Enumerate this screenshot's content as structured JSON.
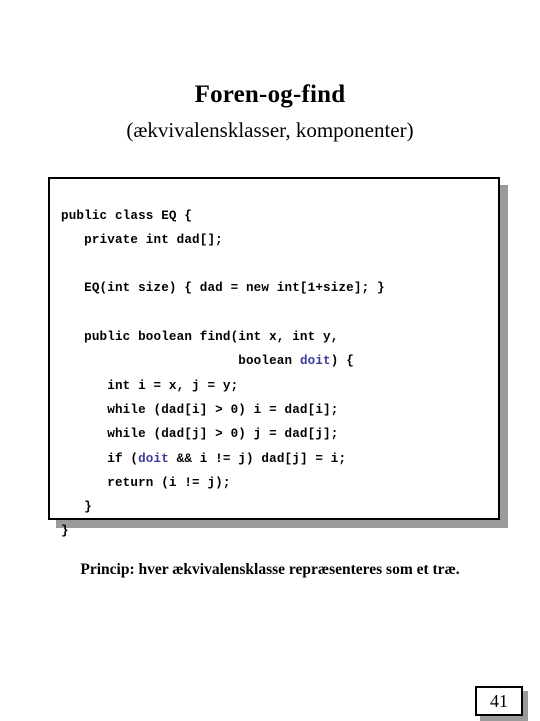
{
  "slide": {
    "title": "Foren-og-find",
    "subtitle": "(ækvivalensklasser, komponenter)",
    "caption": "Princip: hver ækvivalensklasse repræsenteres som et træ.",
    "page_number": "41"
  },
  "code": {
    "language": "java",
    "highlight_color": "#3a3a9c",
    "lines": [
      {
        "id": "l1",
        "text": "public class EQ {"
      },
      {
        "id": "l2",
        "text": "   private int dad[];"
      },
      {
        "id": "l3",
        "text": ""
      },
      {
        "id": "l4",
        "text": "   EQ(int size) { dad = new int[1+size]; }"
      },
      {
        "id": "l5",
        "text": ""
      },
      {
        "id": "l6",
        "pre": "   public boolean find(int x, int y,"
      },
      {
        "id": "l7",
        "pre": "                       boolean ",
        "hl": "doit",
        "post": ") {"
      },
      {
        "id": "l8",
        "text": "      int i = x, j = y;"
      },
      {
        "id": "l9",
        "text": "      while (dad[i] > 0) i = dad[i];"
      },
      {
        "id": "l10",
        "text": "      while (dad[j] > 0) j = dad[j];"
      },
      {
        "id": "l11",
        "pre": "      if (",
        "hl": "doit",
        "post": " && i != j) dad[j] = i;"
      },
      {
        "id": "l12",
        "text": "      return (i != j);"
      },
      {
        "id": "l13",
        "text": "   }"
      },
      {
        "id": "l14",
        "text": "}"
      }
    ]
  }
}
